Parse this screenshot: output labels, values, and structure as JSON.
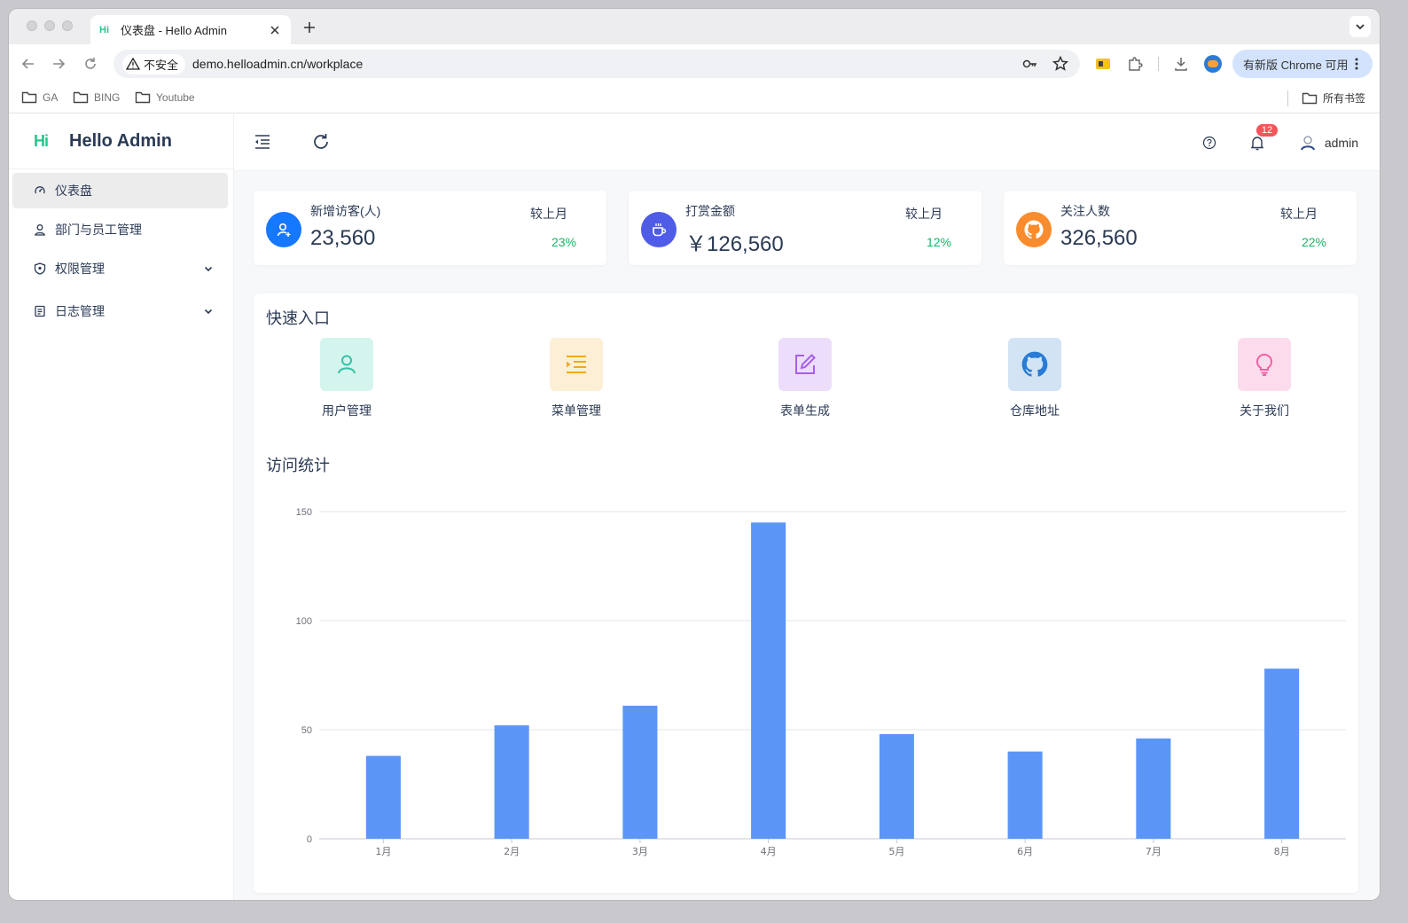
{
  "browser": {
    "tab_title": "仪表盘 - Hello Admin",
    "tab_favicon": "Hi",
    "security_label": "不安全",
    "url": "demo.helloadmin.cn/workplace",
    "update_label": "有新版 Chrome 可用",
    "bookmarks": [
      "GA",
      "BING",
      "Youtube"
    ],
    "all_bookmarks": "所有书签"
  },
  "app": {
    "logo_mark": "Hi",
    "title": "Hello Admin",
    "notification_count": "12",
    "username": "admin"
  },
  "sidebar": {
    "items": [
      {
        "label": "仪表盘",
        "icon": "dashboard-icon",
        "active": true
      },
      {
        "label": "部门与员工管理",
        "icon": "user-icon"
      },
      {
        "label": "权限管理",
        "icon": "shield-icon",
        "expandable": true
      },
      {
        "label": "日志管理",
        "icon": "log-icon",
        "expandable": true
      }
    ]
  },
  "stats": [
    {
      "label": "新增访客(人)",
      "value": "23,560",
      "compare_label": "较上月",
      "percent": "23%",
      "icon": "user-add-icon",
      "color": "#1677ff"
    },
    {
      "label": "打赏金额",
      "value": "￥126,560",
      "compare_label": "较上月",
      "percent": "12%",
      "icon": "coffee-icon",
      "color": "#4f5ce8"
    },
    {
      "label": "关注人数",
      "value": "326,560",
      "compare_label": "较上月",
      "percent": "22%",
      "icon": "github-icon",
      "color": "#fa8c2e"
    }
  ],
  "quick": {
    "title": "快速入口",
    "items": [
      {
        "label": "用户管理",
        "icon": "user-icon",
        "bg": "#d4f5ee",
        "fg": "#35c2a5"
      },
      {
        "label": "菜单管理",
        "icon": "menu-icon",
        "bg": "#fdefd6",
        "fg": "#f5a623"
      },
      {
        "label": "表单生成",
        "icon": "edit-icon",
        "bg": "#ecdefa",
        "fg": "#a660e8"
      },
      {
        "label": "仓库地址",
        "icon": "github-icon",
        "bg": "#d2e4f4",
        "fg": "#2a7bd6"
      },
      {
        "label": "关于我们",
        "icon": "bulb-icon",
        "bg": "#fcdcec",
        "fg": "#f45fa3"
      }
    ]
  },
  "visit": {
    "title": "访问统计"
  },
  "chart_data": {
    "type": "bar",
    "categories": [
      "1月",
      "2月",
      "3月",
      "4月",
      "5月",
      "6月",
      "7月",
      "8月"
    ],
    "values": [
      38,
      52,
      61,
      145,
      48,
      40,
      46,
      78
    ],
    "ylim": [
      0,
      150
    ],
    "yticks": [
      0,
      50,
      100,
      150
    ],
    "grid": true,
    "color": "#5b96f7"
  }
}
